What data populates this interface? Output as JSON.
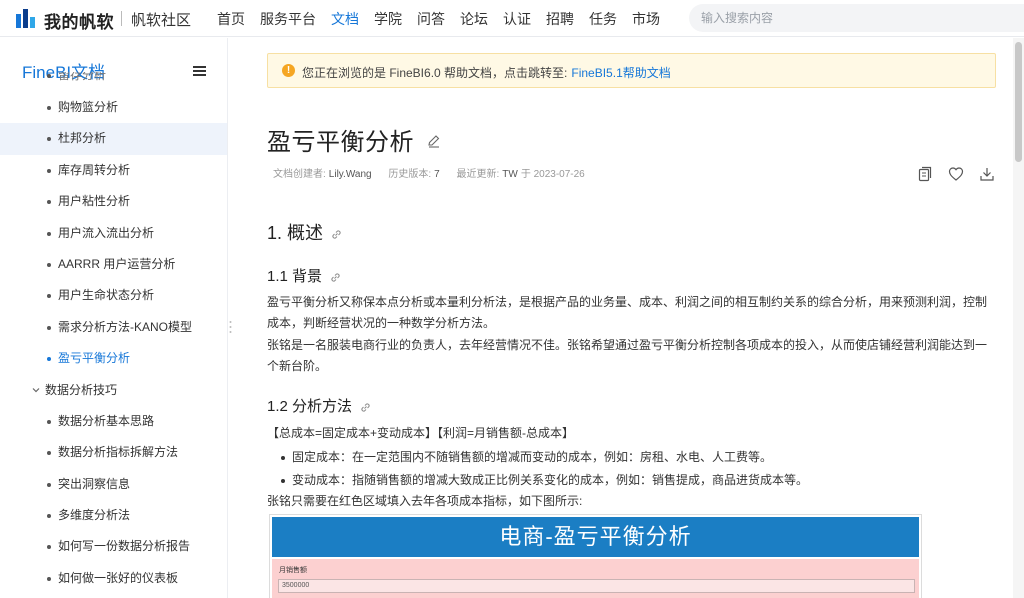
{
  "header": {
    "logo_text": "我的帆软",
    "community": "帆软社区",
    "nav": [
      {
        "label": "首页"
      },
      {
        "label": "服务平台"
      },
      {
        "label": "文档"
      },
      {
        "label": "学院"
      },
      {
        "label": "问答"
      },
      {
        "label": "论坛"
      },
      {
        "label": "认证"
      },
      {
        "label": "招聘"
      },
      {
        "label": "任务"
      },
      {
        "label": "市场"
      }
    ],
    "active_nav": "文档",
    "search_placeholder": "输入搜索内容"
  },
  "sidebar": {
    "title": "FineBI文档",
    "items": [
      {
        "label": "留存分析"
      },
      {
        "label": "购物篮分析"
      },
      {
        "label": "杜邦分析"
      },
      {
        "label": "库存周转分析"
      },
      {
        "label": "用户粘性分析"
      },
      {
        "label": "用户流入流出分析"
      },
      {
        "label": "AARRR 用户运营分析"
      },
      {
        "label": "用户生命状态分析"
      },
      {
        "label": "需求分析方法-KANO模型"
      },
      {
        "label": "盈亏平衡分析"
      }
    ],
    "group": {
      "label": "数据分析技巧"
    },
    "group_items": [
      {
        "label": "数据分析基本思路"
      },
      {
        "label": "数据分析指标拆解方法"
      },
      {
        "label": "突出洞察信息"
      },
      {
        "label": "多维度分析法"
      },
      {
        "label": "如何写一份数据分析报告"
      },
      {
        "label": "如何做一张好的仪表板"
      }
    ]
  },
  "notice": {
    "text": "您正在浏览的是 FineBI6.0 帮助文档，点击跳转至:",
    "link": "FineBI5.1帮助文档"
  },
  "doc": {
    "title": "盈亏平衡分析",
    "meta": {
      "creator_label": "文档创建者:",
      "creator": "Lily.Wang",
      "versions_label": "历史版本:",
      "versions": "7",
      "updated_label": "最近更新:",
      "updated_by": "TW",
      "updated_at": "于 2023-07-26"
    },
    "h1": "1. 概述",
    "h2_background": "1.1 背景",
    "para1": "盈亏平衡分析又称保本点分析或本量利分析法，是根据产品的业务量、成本、利润之间的相互制约关系的综合分析，用来预测利润，控制成本，判断经营状况的一种数学分析方法。",
    "para2": "张铭是一名服装电商行业的负责人，去年经营情况不佳。张铭希望通过盈亏平衡分析控制各项成本的投入，从而使店铺经营利润能达到一个新台阶。",
    "h2_method": "1.2 分析方法",
    "formula": "【总成本=固定成本+变动成本】【利润=月销售额-总成本】",
    "bullets": [
      {
        "text": "固定成本：在一定范围内不随销售额的增减而变动的成本，例如：房租、水电、人工费等。"
      },
      {
        "text": "变动成本：指随销售额的增减大致成正比例关系变化的成本，例如：销售提成，商品进货成本等。"
      }
    ],
    "para3": "张铭只需要在红色区域填入去年各项成本指标，如下图所示:",
    "embed": {
      "title": "电商-盈亏平衡分析",
      "field_label": "月销售额",
      "field_value": "3500000"
    }
  },
  "colors": {
    "accent": "#1677d8",
    "notice_bg": "#fff9e5",
    "embed_header": "#1b7ec4",
    "embed_body": "#fcd0d0"
  }
}
